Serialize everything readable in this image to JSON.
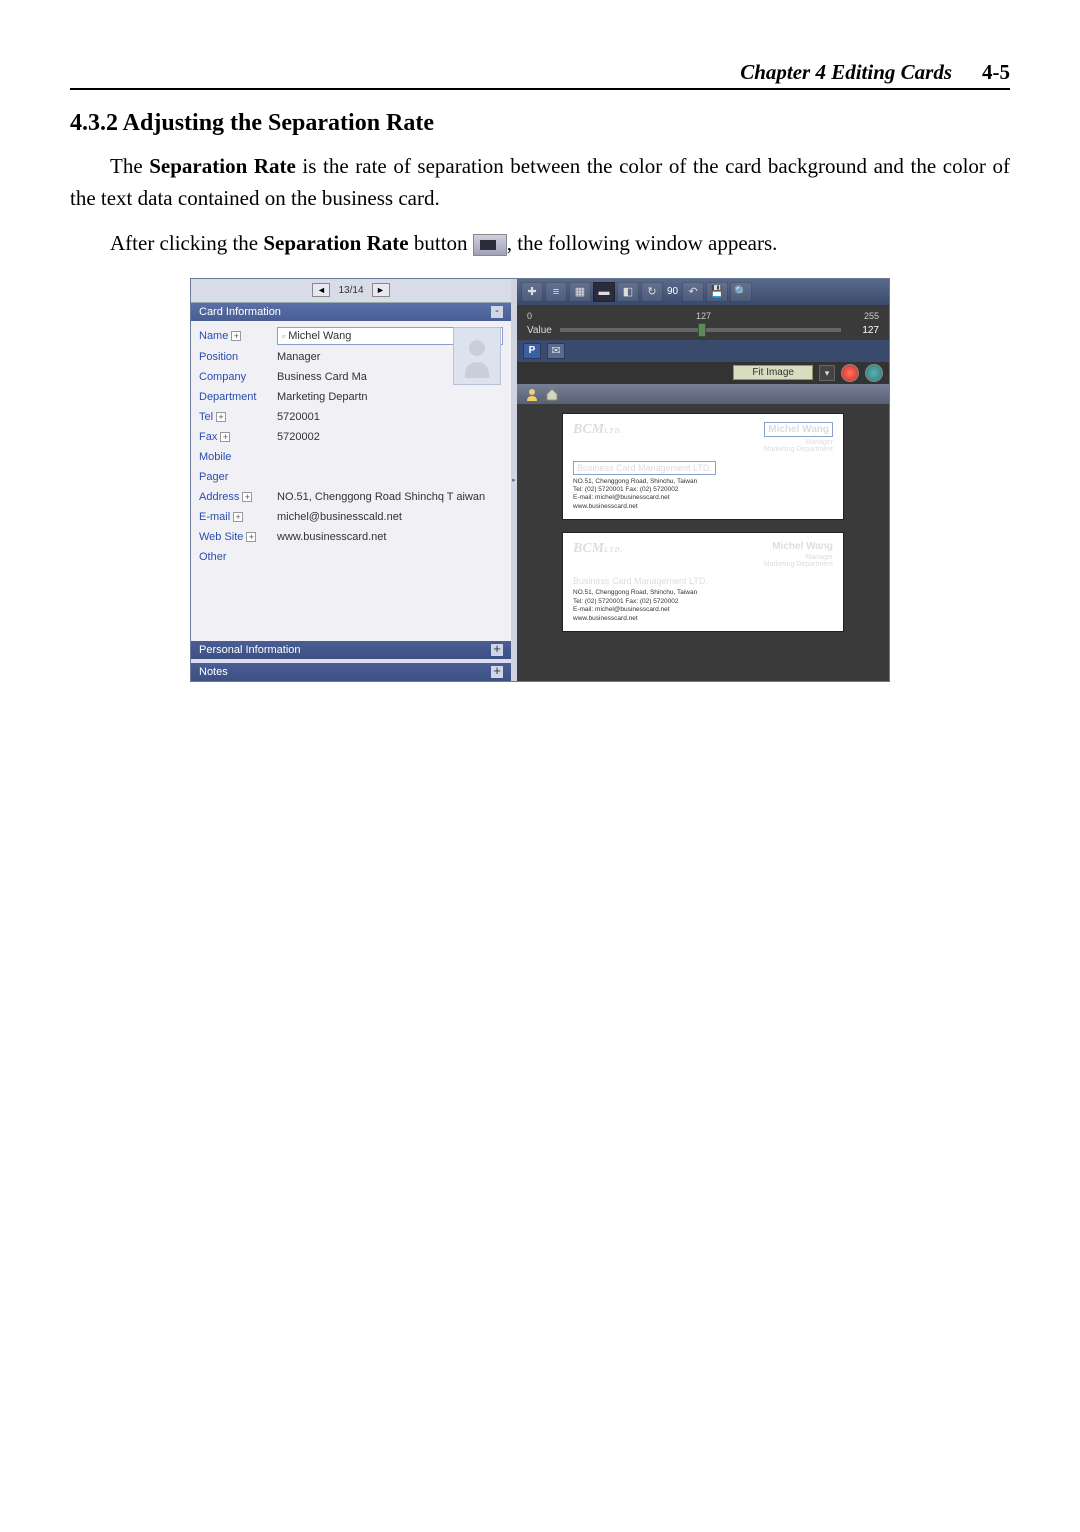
{
  "header": {
    "chapter": "Chapter 4 Editing Cards",
    "page": "4-5"
  },
  "section_title": "4.3.2 Adjusting the Separation Rate",
  "para1_a": "The ",
  "para1_b": "Separation Rate",
  "para1_c": " is the rate of separation between the color of the card background and the color of the text data contained on the business card.",
  "para2_a": "After clicking the ",
  "para2_b": "Separation Rate",
  "para2_c": " button ",
  "para2_d": ", the following window appears.",
  "nav": {
    "prev": "◄",
    "count": "13/14",
    "next": "►"
  },
  "sections": {
    "card_info": "Card Information",
    "personal_info": "Personal Information",
    "notes": "Notes"
  },
  "fields": {
    "name": {
      "label": "Name",
      "value": "Michel Wang"
    },
    "position": {
      "label": "Position",
      "value": "Manager"
    },
    "company": {
      "label": "Company",
      "value": "Business Card Ma"
    },
    "department": {
      "label": "Department",
      "value": "Marketing Departn"
    },
    "tel": {
      "label": "Tel",
      "value": "5720001"
    },
    "fax": {
      "label": "Fax",
      "value": "5720002"
    },
    "mobile": {
      "label": "Mobile",
      "value": ""
    },
    "pager": {
      "label": "Pager",
      "value": ""
    },
    "address": {
      "label": "Address",
      "value": "NO.51, Chenggong Road Shinchq T aiwan"
    },
    "email": {
      "label": "E-mail",
      "value": "michel@businesscald.net"
    },
    "website": {
      "label": "Web Site",
      "value": "www.businesscard.net"
    },
    "other": {
      "label": "Other",
      "value": ""
    }
  },
  "slider": {
    "label": "Value",
    "min": "0",
    "mid": "127",
    "max": "255",
    "value": "127",
    "thumb_pct": 49
  },
  "fit_button": "Fit Image",
  "rotation": "90",
  "card": {
    "logo": "BCM",
    "logo_sub": "LTD.",
    "name": "Michel Wang",
    "title": "Manager",
    "dept": "Marketing Department",
    "company": "Business Card Management  LTD.",
    "addr": "NO.51, Chenggong Road, Shinchu, Taiwan",
    "tel": "Tel: (02) 5720001      Fax: (02) 5720002",
    "email": "E-mail: michel@businesscard.net",
    "web": "www.businesscard.net"
  }
}
